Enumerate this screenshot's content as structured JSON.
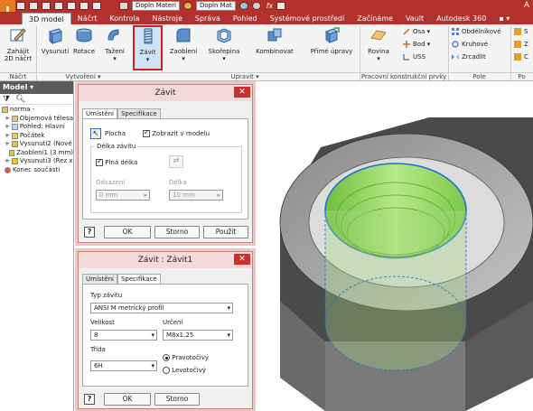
{
  "app_logo": "I",
  "qat": {
    "material1": "Dopln Materi",
    "material2": "Dopln Mat",
    "fx": "fx",
    "corner": "A"
  },
  "tabs": [
    "3D model",
    "Náčrt",
    "Kontrola",
    "Nástroje",
    "Správa",
    "Pohled",
    "Systémové prostředí",
    "Začínáme",
    "Vault",
    "Autodesk 360",
    "▪ ▾"
  ],
  "ribbon": {
    "start_sketch": "Zahájit\n2D náčrt",
    "extrude": "Vysunutí",
    "revolve": "Rotace",
    "sweep": "Tažení",
    "thread": "Závit",
    "fillet": "Zaoblení",
    "shell": "Skořepina",
    "combine": "Kombinovat",
    "direct": "Přímé úpravy",
    "plane": "Rovina",
    "axis": "Osa ▾",
    "point": "Bod ▾",
    "ucs": "USS",
    "rect": "Obdélníkové",
    "circ": "Kruhové",
    "mirror": "Zrcadlit",
    "groups": {
      "sketch": "Náčrt",
      "create": "Vytvoření ▾",
      "modify": "Upravit ▾",
      "work": "Pracovní konstrukční prvky",
      "pattern": "Pole",
      "more": "Po"
    }
  },
  "browser": {
    "title": "Model ▾",
    "items": [
      "norma -",
      "Objemová tělesa",
      "Pohled: Hlavní",
      "Počátek",
      "Vysunutí2 (Nové",
      "Zaoblení1 (3 mm)",
      "Vysunutí3 (Řez x",
      "Konec součásti"
    ]
  },
  "dialog1": {
    "title": "Závit",
    "tab_location": "Umístění",
    "tab_spec": "Specifikace",
    "face_label": "Plocha",
    "show_model": "Zobrazit v modelu",
    "length_group": "Délka závitu",
    "full_length": "Plná délka",
    "offset_label": "Odsazení",
    "length_label": "Délka",
    "offset_value": "0 mm",
    "length_value": "10 mm",
    "ok": "OK",
    "cancel": "Storno",
    "apply": "Použít"
  },
  "dialog2": {
    "title": "Závit : Závit1",
    "tab_location": "Umístění",
    "tab_spec": "Specifikace",
    "thread_type_label": "Typ závitu",
    "thread_type_value": "ANSI M metrický profil",
    "size_label": "Velikost",
    "size_value": "8",
    "designation_label": "Určení",
    "designation_value": "M8x1.25",
    "class_label": "Třída",
    "class_value": "6H",
    "right_hand": "Pravotočivý",
    "left_hand": "Levotočivý",
    "ok": "OK",
    "cancel": "Storno"
  }
}
